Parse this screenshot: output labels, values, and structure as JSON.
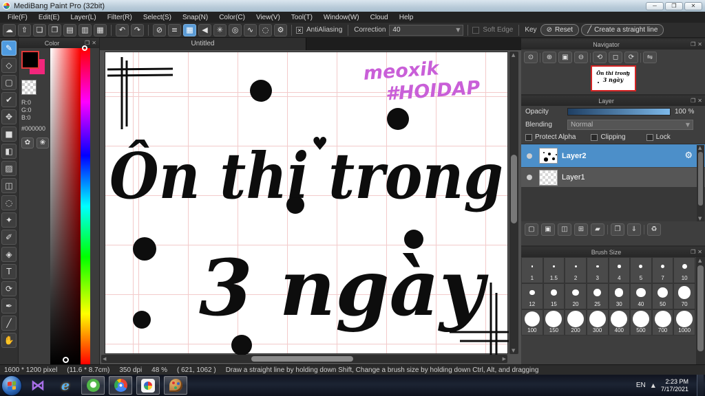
{
  "window": {
    "title": "MediBang Paint Pro (32bit)",
    "controls": [
      {
        "name": "minimize",
        "glyph": "─"
      },
      {
        "name": "restore",
        "glyph": "❐"
      },
      {
        "name": "close",
        "glyph": "✕"
      }
    ]
  },
  "menu": {
    "items": [
      "File(F)",
      "Edit(E)",
      "Layer(L)",
      "Filter(R)",
      "Select(S)",
      "Snap(N)",
      "Color(C)",
      "View(V)",
      "Tool(T)",
      "Window(W)",
      "Cloud",
      "Help"
    ]
  },
  "toolbar": {
    "file_buttons": [
      {
        "name": "cloud",
        "glyph": "☁"
      },
      {
        "name": "publish",
        "glyph": "⇧"
      },
      {
        "name": "comment",
        "glyph": "❏"
      },
      {
        "name": "material-comment",
        "glyph": "❐"
      },
      {
        "name": "document",
        "glyph": "▤"
      },
      {
        "name": "material-panel",
        "glyph": "▥"
      },
      {
        "name": "window-layout",
        "glyph": "▦"
      }
    ],
    "history_buttons": [
      {
        "name": "undo",
        "glyph": "↶"
      },
      {
        "name": "redo",
        "glyph": "↷"
      }
    ],
    "snap_buttons": [
      {
        "name": "snap-off",
        "glyph": "⊘",
        "active": false
      },
      {
        "name": "snap-parallel",
        "glyph": "≡",
        "active": false
      },
      {
        "name": "snap-grid",
        "glyph": "▦",
        "active": true
      },
      {
        "name": "snap-vanishing",
        "glyph": "◀",
        "active": false
      },
      {
        "name": "snap-radial",
        "glyph": "✳",
        "active": false
      },
      {
        "name": "snap-circle",
        "glyph": "◎",
        "active": false
      },
      {
        "name": "snap-curve",
        "glyph": "∿",
        "active": false
      },
      {
        "name": "snap-ellipse",
        "glyph": "◌",
        "active": false
      },
      {
        "name": "snap-settings",
        "glyph": "⚙",
        "active": false
      }
    ],
    "antialiasing_label": "AntiAliasing",
    "correction_label": "Correction",
    "correction_value": "40",
    "soft_edge_label": "Soft Edge",
    "key_label": "Key",
    "reset_label": "Reset",
    "reset_glyph": "⊘",
    "straight_line_label": "Create a straight line",
    "straight_line_glyph": "╱"
  },
  "toolstrip": {
    "tools": [
      {
        "name": "brush",
        "glyph": "✎",
        "selected": true
      },
      {
        "name": "eraser",
        "glyph": "◇",
        "selected": false
      },
      {
        "name": "frame",
        "glyph": "▢",
        "selected": false
      },
      {
        "name": "snap-pen",
        "glyph": "✔",
        "selected": false
      },
      {
        "name": "move",
        "glyph": "✥",
        "selected": false
      },
      {
        "name": "fill",
        "glyph": "■",
        "selected": false
      },
      {
        "name": "bucket",
        "glyph": "◧",
        "selected": false
      },
      {
        "name": "gradient",
        "glyph": "▨",
        "selected": false
      },
      {
        "name": "select",
        "glyph": "◫",
        "selected": false
      },
      {
        "name": "lasso-select",
        "glyph": "◌",
        "selected": false
      },
      {
        "name": "magic-wand",
        "glyph": "✦",
        "selected": false
      },
      {
        "name": "select-pen",
        "glyph": "✐",
        "selected": false
      },
      {
        "name": "select-eraser",
        "glyph": "◈",
        "selected": false
      },
      {
        "name": "text",
        "glyph": "T",
        "selected": false
      },
      {
        "name": "operation",
        "glyph": "⟳",
        "selected": false
      },
      {
        "name": "divide",
        "glyph": "✒",
        "selected": false
      },
      {
        "name": "eyedropper",
        "glyph": "╱",
        "selected": false
      },
      {
        "name": "hand",
        "glyph": "✋",
        "selected": false
      }
    ]
  },
  "color_panel": {
    "title": "Color",
    "r": "R:0",
    "g": "G:0",
    "b": "B:0",
    "hex": "#000000",
    "foreground_color": "#000000",
    "secondary_color": "#f2267c",
    "palette_buttons": [
      {
        "name": "palette",
        "glyph": "✿"
      },
      {
        "name": "palette-edit",
        "glyph": "❀"
      }
    ]
  },
  "canvas": {
    "tab_title": "Untitled",
    "artwork": {
      "line1": "Ôn thi trong",
      "line2": "3 ngày",
      "heart": "♥",
      "signature_line1": "meoxik",
      "signature_line2": "#HOIDAP",
      "signature_color": "#c95fd8",
      "ink_color": "#0d0d0d",
      "grid_color": "#f3caca"
    }
  },
  "navigator": {
    "title": "Navigator",
    "buttons": [
      {
        "name": "zoom-actual",
        "glyph": "⊙"
      },
      {
        "name": "zoom-in",
        "glyph": "⊕"
      },
      {
        "name": "fit-window",
        "glyph": "▣"
      },
      {
        "name": "zoom-out",
        "glyph": "⊖"
      },
      {
        "name": "rotate-ccw",
        "glyph": "⟲"
      },
      {
        "name": "reset-rotation",
        "glyph": "◻"
      },
      {
        "name": "rotate-cw",
        "glyph": "⟳"
      },
      {
        "name": "flip-horizontal",
        "glyph": "⇋"
      }
    ]
  },
  "layer_panel": {
    "title": "Layer",
    "opacity_label": "Opacity",
    "opacity_value": "100 %",
    "blending_label": "Blending",
    "blending_value": "Normal",
    "protect_alpha_label": "Protect Alpha",
    "clipping_label": "Clipping",
    "lock_label": "Lock",
    "layers": [
      {
        "name": "Layer2",
        "selected": true
      },
      {
        "name": "Layer1",
        "selected": false
      }
    ],
    "toolbar_buttons": [
      {
        "name": "add-layer",
        "glyph": "▢"
      },
      {
        "name": "add-8bit-layer",
        "glyph": "▣"
      },
      {
        "name": "add-1bit-layer",
        "glyph": "◫"
      },
      {
        "name": "add-layer-menu",
        "glyph": "⊞"
      },
      {
        "name": "folder",
        "glyph": "▰"
      },
      {
        "name": "duplicate-layer",
        "glyph": "❐"
      },
      {
        "name": "merge-layer",
        "glyph": "⇓"
      },
      {
        "name": "delete-layer",
        "glyph": "♻"
      }
    ]
  },
  "brush_panel": {
    "title": "Brush Size",
    "sizes": [
      "1",
      "1.5",
      "2",
      "3",
      "4",
      "5",
      "7",
      "10",
      "12",
      "15",
      "20",
      "25",
      "30",
      "40",
      "50",
      "70",
      "100",
      "150",
      "200",
      "300",
      "400",
      "500",
      "700",
      "1000"
    ]
  },
  "statusbar": {
    "dimensions": "1600 * 1200 pixel",
    "size_cm": "(11.6 * 8.7cm)",
    "dpi": "350 dpi",
    "zoom": "48 %",
    "coords": "( 621, 1062 )",
    "hint": "Draw a straight line by holding down Shift, Change a brush size by holding down Ctrl, Alt, and dragging"
  },
  "taskbar": {
    "apps": [
      {
        "name": "kmplayer",
        "active": false
      },
      {
        "name": "internet-explorer",
        "active": false
      },
      {
        "name": "coccoc",
        "active": true
      },
      {
        "name": "chrome",
        "active": true
      },
      {
        "name": "medibang",
        "active": true
      },
      {
        "name": "medibang-paint",
        "active": true
      }
    ],
    "language": "EN",
    "time": "2:23 PM",
    "date": "7/17/2021"
  }
}
